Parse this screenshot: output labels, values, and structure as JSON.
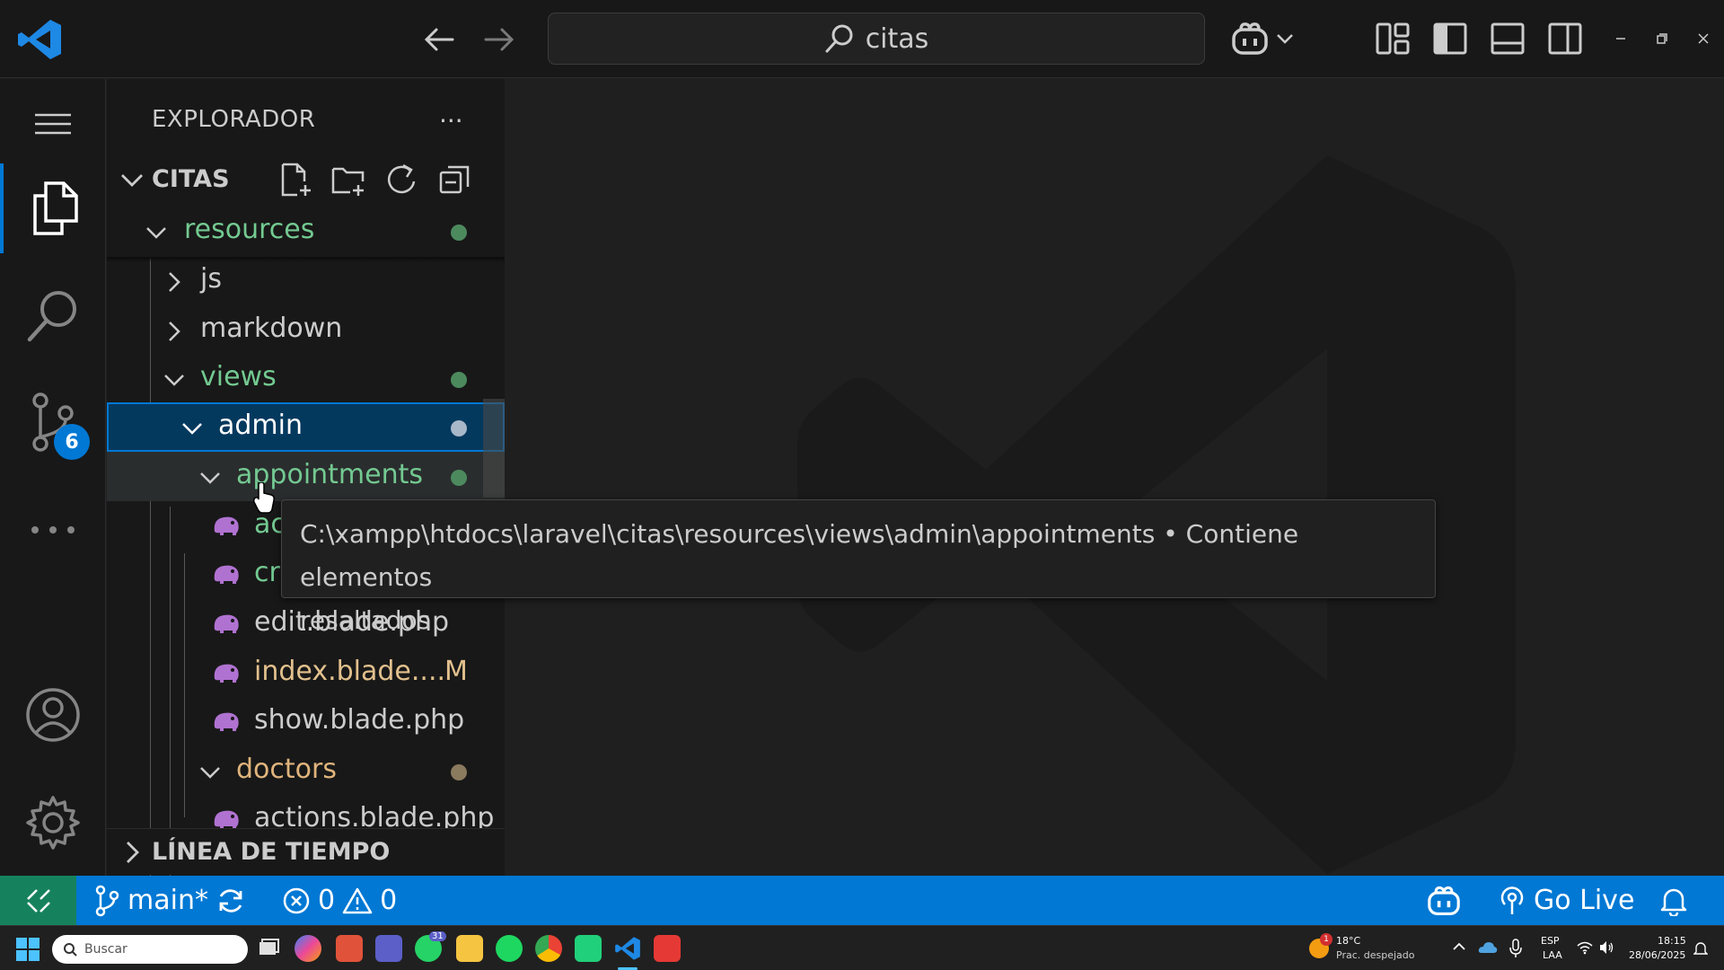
{
  "titlebar": {
    "search_text": "citas"
  },
  "activity": {
    "scm_badge": "6"
  },
  "sidebar": {
    "title": "EXPLORADOR",
    "more": "···",
    "root": "CITAS",
    "rows": [
      {
        "label": "resources",
        "color": "#73c991"
      },
      {
        "label": "js",
        "color": "#cccccc"
      },
      {
        "label": "markdown",
        "color": "#cccccc"
      },
      {
        "label": "views",
        "color": "#73c991"
      },
      {
        "label": "admin",
        "color": "#cccccc"
      },
      {
        "label": "appointments",
        "color": "#73c991"
      },
      {
        "label": "ac",
        "color": "#73c991"
      },
      {
        "label": "cr",
        "color": "#73c991"
      },
      {
        "label": "edit.blade.php",
        "color": "#cccccc"
      },
      {
        "label": "index.blade....",
        "color": "#e2c08d",
        "badge": "M"
      },
      {
        "label": "show.blade.php",
        "color": "#cccccc"
      },
      {
        "label": "doctors",
        "color": "#e0b47c"
      },
      {
        "label": "actions.blade.php",
        "color": "#cccccc"
      }
    ],
    "timeline": "LÍNEA DE TIEMPO"
  },
  "tooltip": {
    "line1": "C:\\xampp\\htdocs\\laravel\\citas\\resources\\views\\admin\\appointments • Contiene elementos",
    "line2": "resaltados"
  },
  "statusbar": {
    "branch": "main*",
    "errors": "0",
    "warnings": "0",
    "go_live": "Go Live"
  },
  "taskbar": {
    "search_placeholder": "Buscar",
    "weather_temp": "18°C",
    "weather_desc": "Prac. despejado",
    "weather_badge": "1",
    "lang_top": "ESP",
    "lang_bottom": "LAA",
    "time": "18:15",
    "date": "28/06/2025",
    "teams_badge": "31"
  }
}
